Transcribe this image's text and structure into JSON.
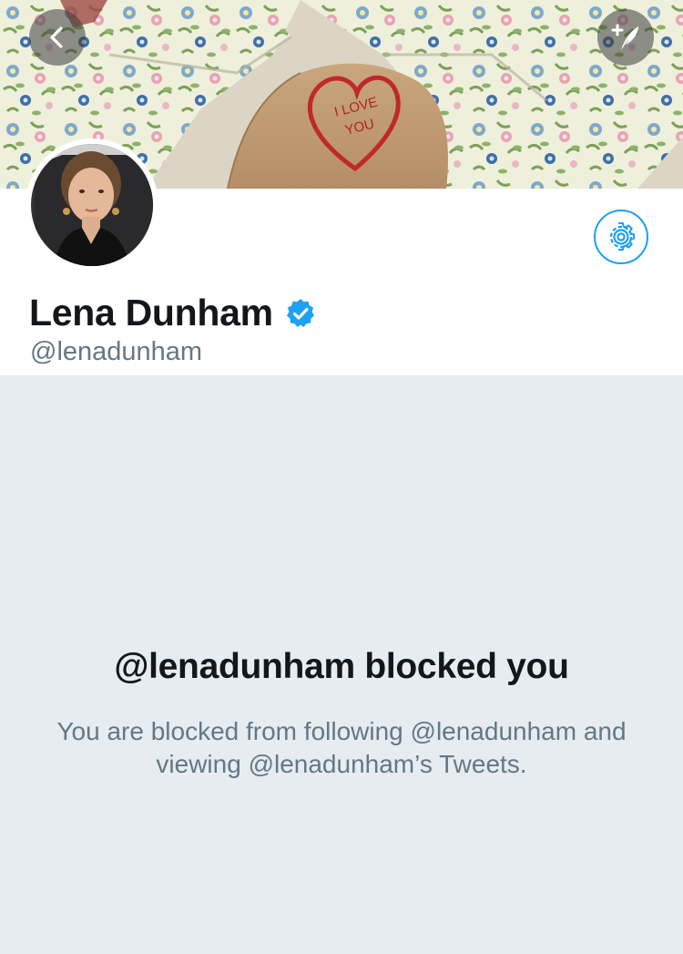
{
  "header": {
    "back_icon": "chevron-left-icon",
    "compose_icon": "compose-tweet-icon",
    "banner_text": "I LOVE YOU"
  },
  "profile": {
    "display_name": "Lena Dunham",
    "handle": "@lenadunham",
    "verified": true,
    "settings_icon": "gear-icon"
  },
  "blocked": {
    "title": "@lenadunham blocked you",
    "description": "You are blocked from following @lenadunham and viewing @lenadunham’s Tweets."
  },
  "colors": {
    "accent": "#1da1f2",
    "text_primary": "#14171a",
    "text_secondary": "#657786",
    "background": "#e6ecf0"
  }
}
